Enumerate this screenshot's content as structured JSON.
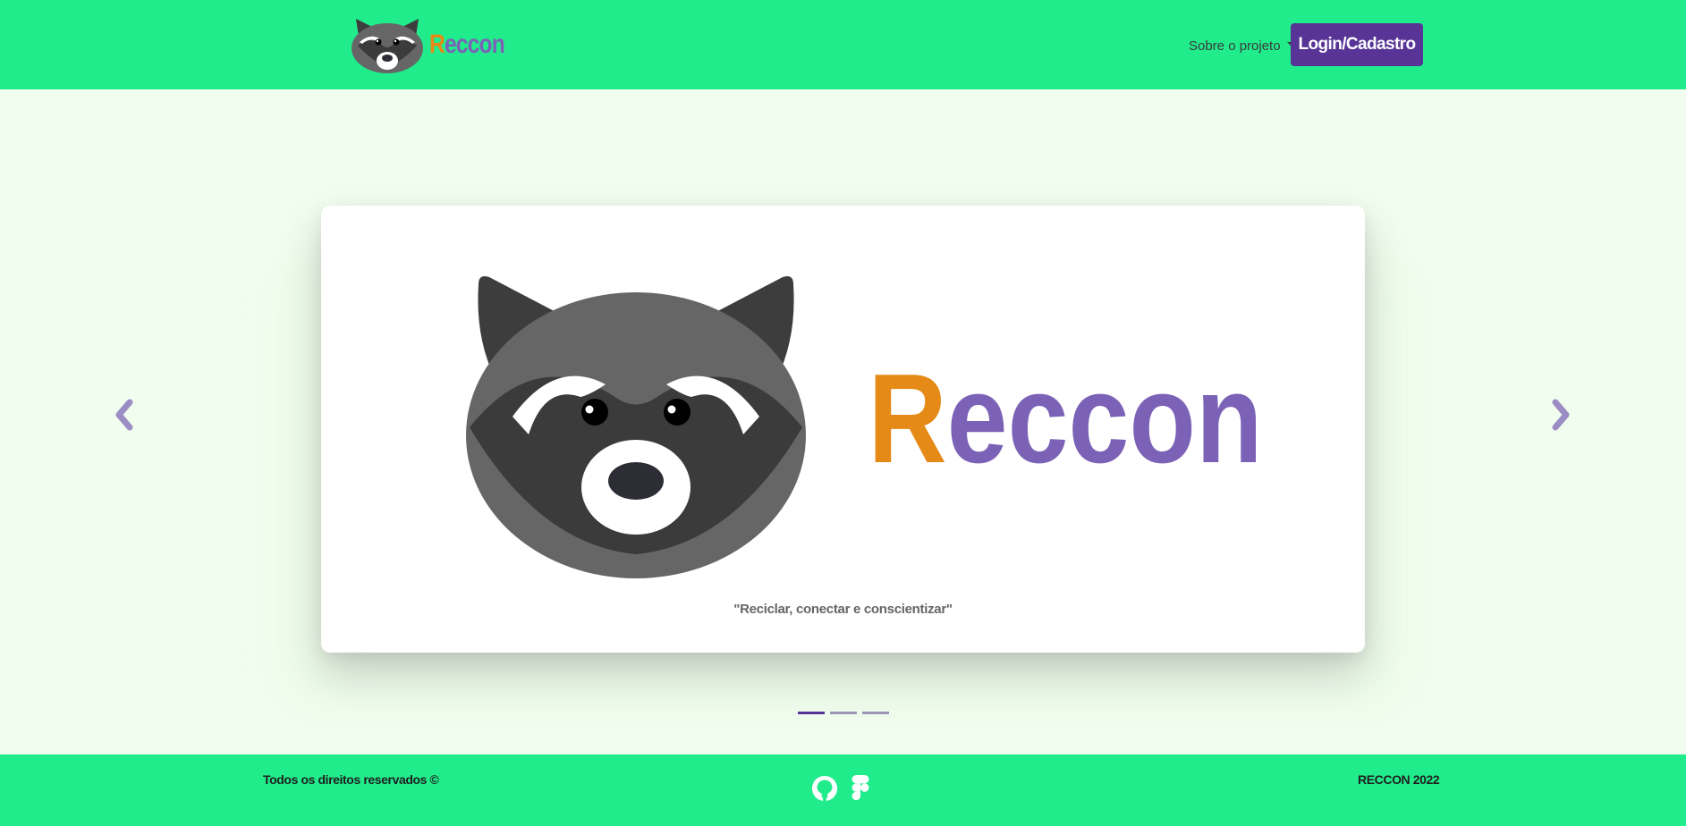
{
  "header": {
    "brand_initial": "R",
    "brand_rest": "eccon",
    "dropdown_label": "Sobre o projeto",
    "login_label": "Login/Cadastro"
  },
  "carousel": {
    "slide_logo_initial": "R",
    "slide_logo_rest": "eccon",
    "caption": "\"Reciclar, conectar e conscientizar\"",
    "active_slide": 1,
    "slide_count": 3
  },
  "footer": {
    "rights": "Todos os direitos reservados ©",
    "copyright": "RECCON 2022",
    "icons": [
      "github-icon",
      "figma-icon"
    ]
  },
  "colors": {
    "header_bg": "#21ec8c",
    "page_bg": "#f1fdee",
    "brand_orange": "#e68a17",
    "brand_purple": "#7b62b6",
    "button_bg": "#573496"
  }
}
